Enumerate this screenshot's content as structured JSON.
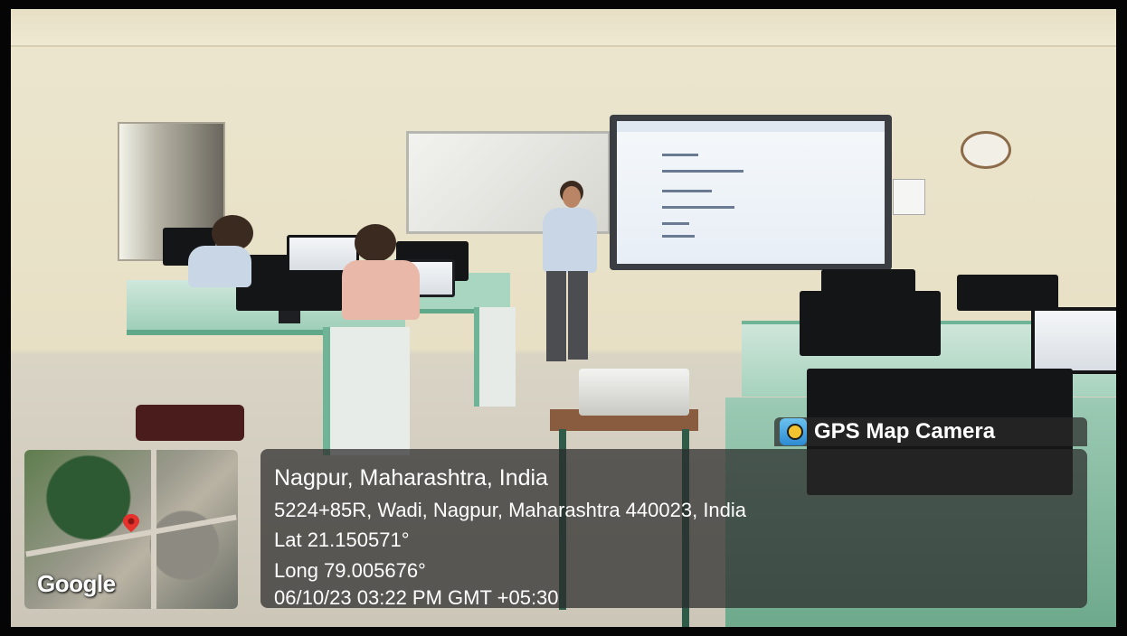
{
  "location": {
    "title": "Nagpur, Maharashtra, India",
    "address": "5224+85R, Wadi, Nagpur, Maharashtra 440023, India",
    "latitude": "Lat 21.150571°",
    "longitude": "Long 79.005676°",
    "timestamp": "06/10/23 03:22 PM GMT +05:30"
  },
  "badge": {
    "app_name": "GPS Map Camera",
    "icon": "camera-pin-icon"
  },
  "map": {
    "brand": "Google",
    "pin_icon": "location-pin-icon",
    "pin_color": "#e5322d"
  },
  "colors": {
    "overlay": "#2a2a2a",
    "desk_green": "#6fb497"
  }
}
